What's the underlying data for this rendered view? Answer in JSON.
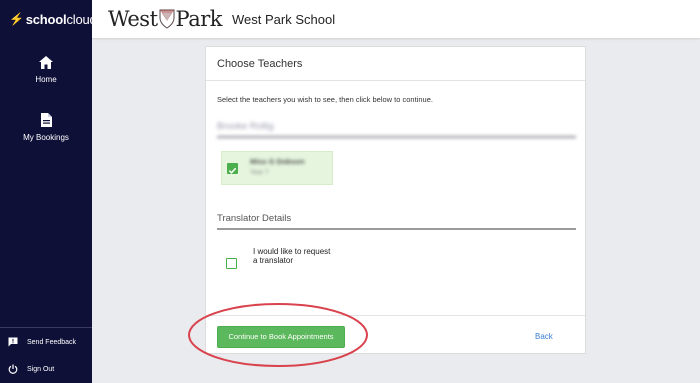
{
  "sidebar": {
    "brand_school": "school",
    "brand_cloud": "cloud",
    "nav": [
      {
        "label": "Home",
        "icon": "home-icon"
      },
      {
        "label": "My Bookings",
        "icon": "document-icon"
      }
    ],
    "footer": [
      {
        "label": "Send Feedback",
        "icon": "feedback-icon"
      },
      {
        "label": "Sign Out",
        "icon": "power-icon"
      }
    ]
  },
  "header": {
    "logo_left": "West",
    "logo_right": "Park",
    "school_name": "West Park School"
  },
  "card": {
    "title": "Choose Teachers",
    "instruction": "Select the teachers you wish to see, then click below to continue.",
    "parent_section": "Brooke Rollig",
    "teacher": {
      "name": "Miss G Dobson",
      "subject": "Year 7",
      "checked": true
    },
    "translator_section": "Translator Details",
    "translator_option": {
      "label": "I would like to request a translator",
      "checked": false
    },
    "continue_label": "Continue to Book Appointments",
    "back_label": "Back"
  },
  "colors": {
    "sidebar_bg": "#0f1038",
    "accent_green": "#5cb85c",
    "link_blue": "#3a7fd5",
    "annotation_red": "#d9434e"
  }
}
